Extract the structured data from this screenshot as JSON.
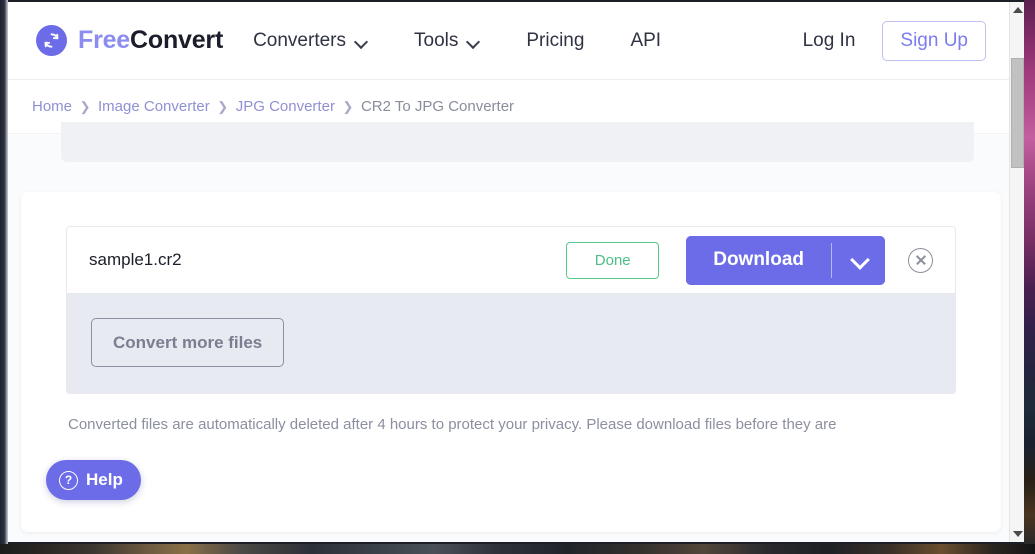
{
  "brand": {
    "icon": "refresh-circle-icon",
    "text_light": "Free",
    "text_bold": "Convert",
    "accent_color": "#6c6ce8"
  },
  "header": {
    "nav": [
      {
        "label": "Converters",
        "has_dropdown": true
      },
      {
        "label": "Tools",
        "has_dropdown": true
      },
      {
        "label": "Pricing",
        "has_dropdown": false
      },
      {
        "label": "API",
        "has_dropdown": false
      }
    ],
    "login_label": "Log In",
    "signup_label": "Sign Up",
    "signup_color": "#7b7cf0"
  },
  "breadcrumb": {
    "separator": "❯",
    "items": [
      {
        "label": "Home",
        "current": false
      },
      {
        "label": "Image Converter",
        "current": false
      },
      {
        "label": "JPG Converter",
        "current": false
      },
      {
        "label": "CR2 To JPG Converter",
        "current": true
      }
    ]
  },
  "conversion": {
    "file_name": "sample1.cr2",
    "status_label": "Done",
    "status_color": "#4cbf84",
    "download_label": "Download",
    "download_caret_icon": "chevron-down-icon",
    "remove_icon": "close-circle-icon",
    "convert_more_label": "Convert more files",
    "privacy_note": "Converted files are automatically deleted after 4 hours to protect your privacy. Please download files before they are"
  },
  "help": {
    "icon": "question-circle-icon",
    "label": "Help"
  },
  "scrollbar": {
    "up_icon": "scroll-up-arrow-icon",
    "down_icon": "scroll-down-arrow-icon"
  }
}
